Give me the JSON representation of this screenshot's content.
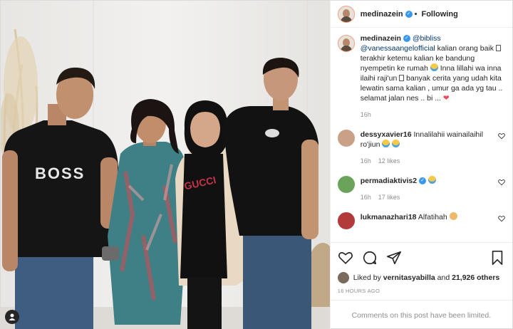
{
  "header": {
    "username": "medinazein",
    "separator": "•",
    "follow_status": "Following"
  },
  "photo": {
    "shirt_text": "BOSS"
  },
  "caption": {
    "username": "medinazein",
    "mention1": "@bibliss",
    "mention2": "@vanessaangelofficial",
    "text1": " kalian orang baik",
    "text2": " terakhir ketemu kalian ke bandung nyempetin ke rumah ",
    "text3": " Inna lillahi wa inna ilaihi raji'un ",
    "text4": " banyak cerita yang udah kita lewatin sama kalian , umur ga ada yg tau .. selamat jalan nes .. bi ... ",
    "heart": "❤",
    "time": "16h"
  },
  "comments": [
    {
      "username": "dessyxavier16",
      "text": "Innalilahii wainailaihil ro'jiun ",
      "time": "16h",
      "likes": "12 likes",
      "avatar_color": "#c9a187"
    },
    {
      "username": "permadiaktivis2",
      "text": "",
      "time": "16h",
      "likes": "17 likes",
      "avatar_color": "#6aa35a"
    },
    {
      "username": "lukmanazhari18",
      "text": "Alfatihah ",
      "time": "",
      "likes": "",
      "avatar_color": "#b33a3a"
    }
  ],
  "likes": {
    "prefix": "Liked by ",
    "user": "vernitasyabilla",
    "middle": " and ",
    "count": "21,926 others"
  },
  "timestamp": "16 HOURS AGO",
  "limited_text": "Comments on this post have been limited.",
  "icons": [
    "heart-icon",
    "comment-icon",
    "share-icon",
    "bookmark-icon",
    "verified-icon",
    "user-tag-icon"
  ],
  "colors": {
    "verified": "#3897f0",
    "link": "#00376b",
    "muted": "#8e8e8e",
    "heart": "#ed4956"
  }
}
